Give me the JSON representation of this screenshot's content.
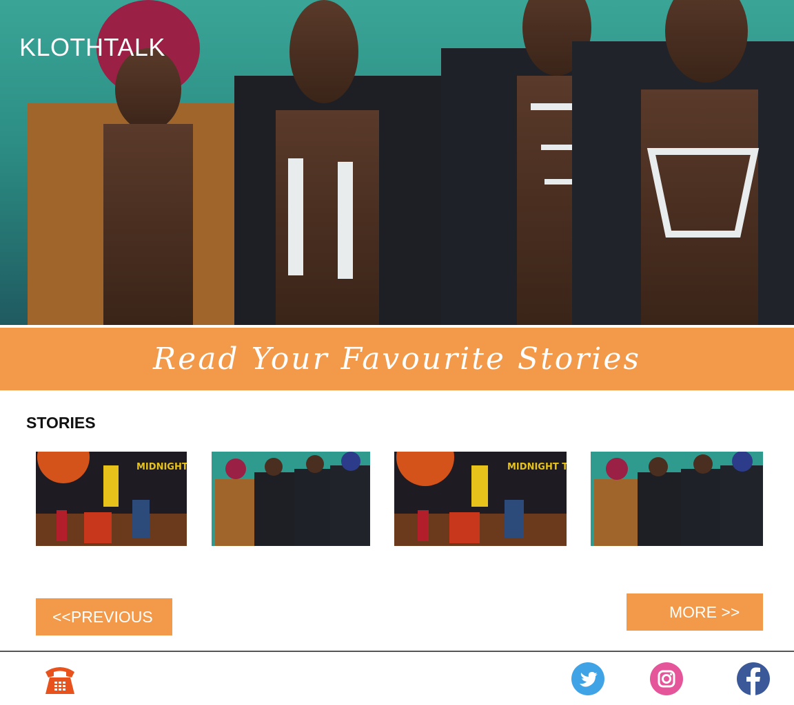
{
  "header": {
    "brand": "KLOTHTALK"
  },
  "banner": {
    "text": "Read Your Favourite Stories"
  },
  "stories": {
    "title": "STORIES",
    "items": [
      {
        "caption": "MIDNIGHT TRAIN",
        "scene": "moon-desert"
      },
      {
        "caption": "",
        "scene": "teal-group"
      },
      {
        "caption": "MIDNIGHT TRAIN",
        "scene": "moon-desert"
      },
      {
        "caption": "",
        "scene": "teal-group"
      }
    ]
  },
  "pagination": {
    "previous_label": "<<PREVIOUS",
    "more_label": "MORE >>"
  },
  "footer": {
    "icons": [
      "phone-icon",
      "twitter-icon",
      "instagram-icon",
      "facebook-icon"
    ]
  },
  "colors": {
    "accent": "#f29a4a",
    "hero_teal": "#2f9a8e",
    "twitter": "#3fa3e6",
    "facebook": "#3b5998"
  }
}
